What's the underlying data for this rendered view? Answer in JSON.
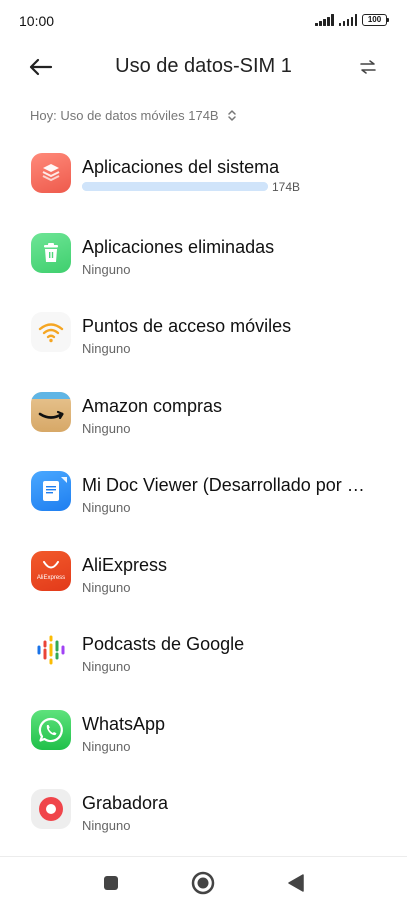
{
  "status_bar": {
    "time": "10:00",
    "battery": "100"
  },
  "header": {
    "title": "Uso de datos-SIM 1"
  },
  "filter": {
    "label": "Hoy: Uso de datos móviles 174B"
  },
  "apps": [
    {
      "name": "Aplicaciones del sistema",
      "usage": "174B",
      "usage_fraction": 1.0
    },
    {
      "name": "Aplicaciones eliminadas",
      "usage": "Ninguno"
    },
    {
      "name": "Puntos de acceso móviles",
      "usage": "Ninguno"
    },
    {
      "name": "Amazon compras",
      "usage": "Ninguno"
    },
    {
      "name": "Mi Doc Viewer (Desarrollado por WPS Office)",
      "usage": "Ninguno"
    },
    {
      "name": "AliExpress",
      "usage": "Ninguno",
      "icon_text": "AliExpress"
    },
    {
      "name": "Podcasts de Google",
      "usage": "Ninguno"
    },
    {
      "name": "WhatsApp",
      "usage": "Ninguno"
    },
    {
      "name": "Grabadora",
      "usage": "Ninguno"
    }
  ],
  "icons": {
    "back": "back-arrow-icon",
    "switch": "swap-arrows-icon",
    "expand": "updown-chevron-icon",
    "nav_recents": "square-icon",
    "nav_home": "circle-icon",
    "nav_back": "triangle-back-icon"
  },
  "colors": {
    "usage_bar": "#d0e4fa",
    "system_apps": "#f26b5b",
    "deleted_apps": "#4fd87a",
    "hotspot": "#f5a623",
    "aliexpress": "#e8401c",
    "whatsapp": "#25d366",
    "recorder": "#f0454b"
  }
}
